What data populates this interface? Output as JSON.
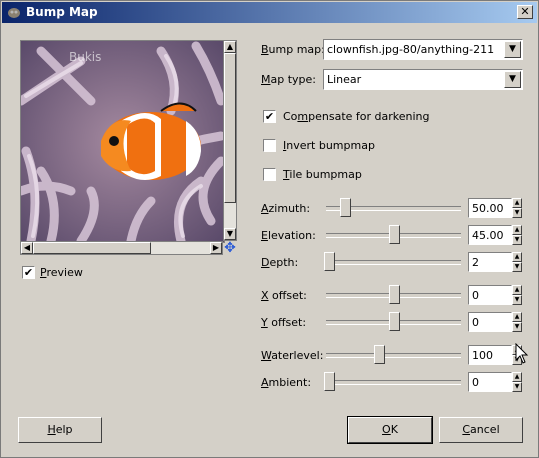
{
  "window": {
    "title": "Bump Map",
    "close_label": "✕"
  },
  "preview": {
    "image_text": "Bukis",
    "checkbox_checked": true,
    "label_prefix": "",
    "label_accel": "P",
    "label_rest": "review"
  },
  "form": {
    "bump_map": {
      "label_accel": "B",
      "label_rest": "ump map:",
      "value": "clownfish.jpg-80/anything-211"
    },
    "map_type": {
      "label_accel": "M",
      "label_rest": "ap type:",
      "value": "Linear"
    },
    "compensate": {
      "checked": true,
      "label_pre": "Co",
      "label_accel": "m",
      "label_rest": "pensate for darkening"
    },
    "invert": {
      "checked": false,
      "label_accel": "I",
      "label_rest": "nvert bumpmap"
    },
    "tile": {
      "checked": false,
      "label_accel": "T",
      "label_rest": "ile bumpmap"
    }
  },
  "sliders": {
    "azimuth": {
      "label_accel": "A",
      "label_rest": "zimuth:",
      "value": "50.00",
      "fraction": 0.14
    },
    "elevation": {
      "label_accel": "E",
      "label_rest": "levation:",
      "value": "45.00",
      "fraction": 0.5
    },
    "depth": {
      "label_accel": "D",
      "label_rest": "epth:",
      "value": "2",
      "fraction": 0.02
    },
    "x_offset": {
      "label_accel": "X",
      "label_rest": " offset:",
      "value": "0",
      "fraction": 0.5
    },
    "y_offset": {
      "label_accel": "Y",
      "label_rest": " offset:",
      "value": "0",
      "fraction": 0.5
    },
    "waterlevel": {
      "label_accel": "W",
      "label_rest": "aterlevel:",
      "value": "100",
      "fraction": 0.39
    },
    "ambient": {
      "label_accel": "A",
      "label_rest": "mbient:",
      "value": "0",
      "fraction": 0.02
    }
  },
  "buttons": {
    "help": {
      "accel": "H",
      "rest": "elp"
    },
    "ok": {
      "accel": "O",
      "rest": "K"
    },
    "cancel": {
      "accel": "C",
      "rest": "ancel"
    }
  },
  "colors": {
    "title_start": "#0a246a",
    "title_end": "#a6caf0",
    "face": "#d4d0c8"
  }
}
